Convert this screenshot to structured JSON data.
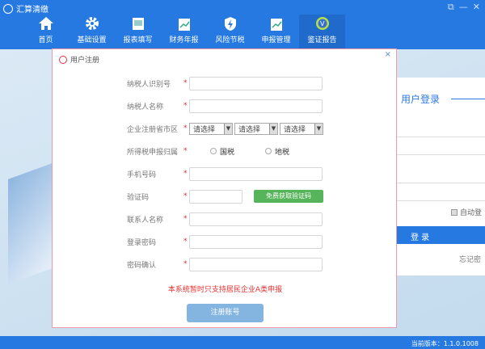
{
  "app": {
    "title": "汇算清缴",
    "window_controls": [
      "restore",
      "minimize",
      "close"
    ]
  },
  "nav": [
    {
      "label": "首页",
      "icon": "home-icon"
    },
    {
      "label": "基础设置",
      "icon": "gear-icon"
    },
    {
      "label": "报表填写",
      "icon": "report-icon"
    },
    {
      "label": "财务年报",
      "icon": "chart-clipboard-icon"
    },
    {
      "label": "风险节税",
      "icon": "shield-icon"
    },
    {
      "label": "申报管理",
      "icon": "chart-clipboard-icon"
    },
    {
      "label": "鉴证报告",
      "icon": "badge-v-icon"
    }
  ],
  "dialog": {
    "title": "用户注册",
    "close": "×",
    "fields": {
      "taxpayer_id": "纳税人识别号",
      "taxpayer_name": "纳税人名称",
      "region": "企业注册省市区",
      "tax_authority": "所得税申报归属",
      "phone": "手机号码",
      "code": "验证码",
      "contact": "联系人名称",
      "password": "登录密码",
      "confirm": "密码确认"
    },
    "star": "*",
    "select_placeholder": "请选择",
    "radio": {
      "national": "国税",
      "local": "地税"
    },
    "sms_button": "免费获取验证码",
    "notice": "本系统暂时只支持居民企业A类申报",
    "register_button": "注册账号"
  },
  "login": {
    "title": "用户登录",
    "auto_login": "自动登",
    "login_button": "登 录",
    "forgot": "忘记密"
  },
  "footer": {
    "version": "当前版本：1.1.0.1008"
  }
}
